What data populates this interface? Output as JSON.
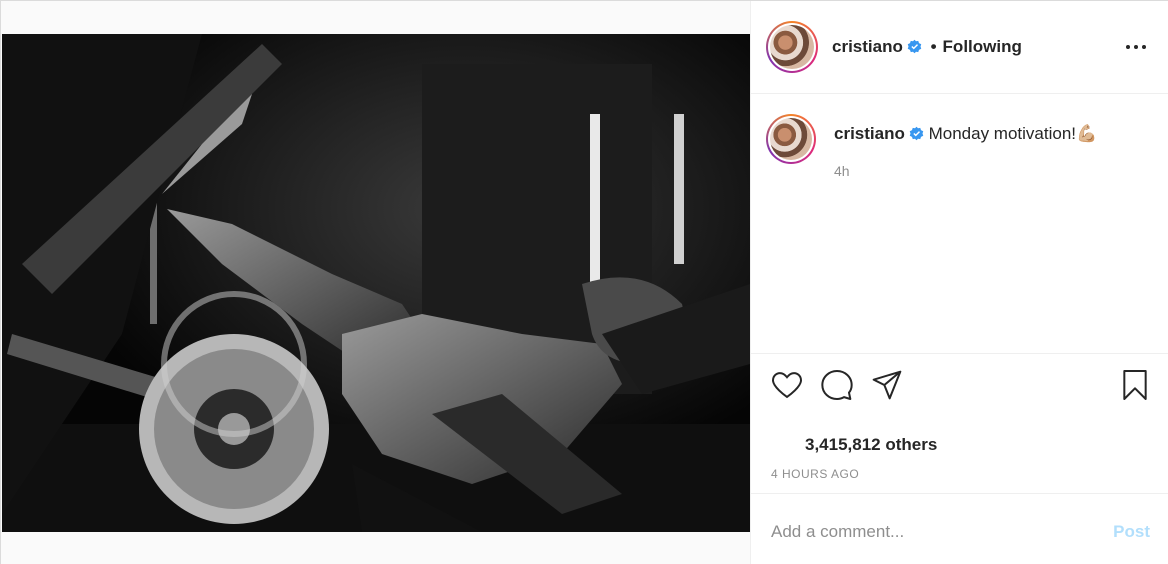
{
  "post": {
    "photo": {
      "alt": "cristiano post photo"
    },
    "header": {
      "username": "cristiano",
      "separator": "•",
      "follow_status": "Following",
      "verified": true
    },
    "caption": {
      "username": "cristiano",
      "text": "Monday motivation!",
      "emoji": "💪🏼",
      "time": "4h"
    },
    "actions": {
      "icons": [
        "heart-icon",
        "comment-icon",
        "share-icon",
        "bookmark-icon"
      ]
    },
    "likes": "3,415,812 others",
    "posted_ago": "4 HOURS AGO",
    "comment_box": {
      "placeholder": "Add a comment...",
      "post_label": "Post"
    }
  },
  "colors": {
    "verified_blue": "#3897f0",
    "post_button_disabled": "#b2dffc",
    "muted_text": "#8e8e8e"
  }
}
